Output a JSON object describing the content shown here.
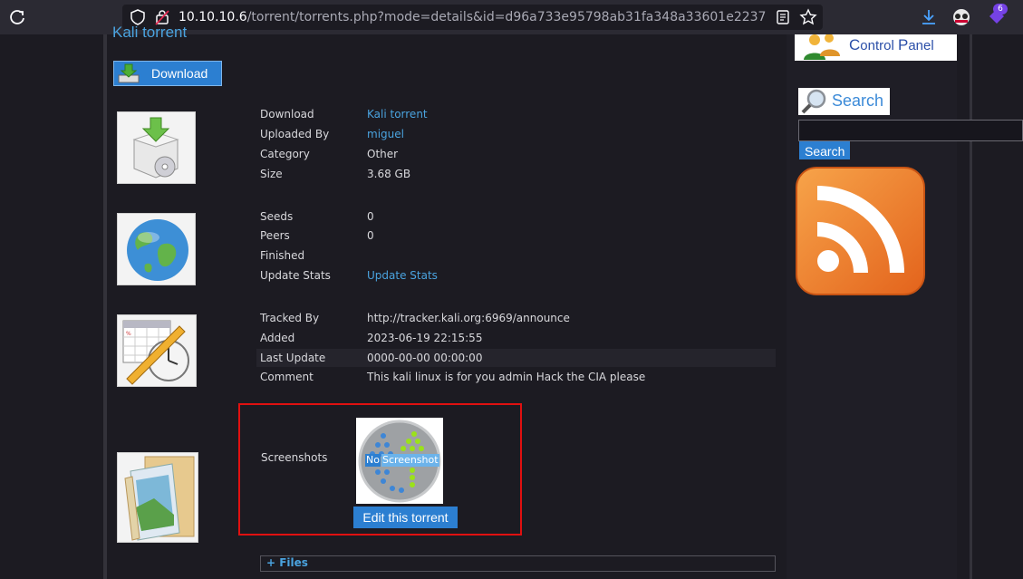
{
  "browser": {
    "url_host": "10.10.10.6",
    "url_path": "/torrent/torrents.php?mode=details&id=d96a733e95798ab31fa348a33601e2237",
    "ext_badge": "6"
  },
  "torrent": {
    "title": "Kali torrent",
    "download_label": "Download"
  },
  "details": {
    "download": {
      "label": "Download",
      "value": "Kali torrent"
    },
    "uploaded_by": {
      "label": "Uploaded By",
      "value": "miguel"
    },
    "category": {
      "label": "Category",
      "value": "Other"
    },
    "size": {
      "label": "Size",
      "value": "3.68 GB"
    },
    "seeds": {
      "label": "Seeds",
      "value": "0"
    },
    "peers": {
      "label": "Peers",
      "value": "0"
    },
    "finished": {
      "label": "Finished",
      "value": ""
    },
    "update_stats": {
      "label": "Update Stats",
      "value": "Update Stats"
    },
    "tracked_by": {
      "label": "Tracked By",
      "value": "http://tracker.kali.org:6969/announce"
    },
    "added": {
      "label": "Added",
      "value": "2023-06-19 22:15:55"
    },
    "last_update": {
      "label": "Last Update",
      "value": "0000-00-00 00:00:00"
    },
    "comment": {
      "label": "Comment",
      "value": "This kali linux is for you admin Hack the CIA please"
    },
    "screenshots": {
      "label": "Screenshots",
      "no_screenshot_no": "No",
      "no_screenshot_text": "Screenshot"
    },
    "edit_label": "Edit this torrent",
    "files_label": "+ Files"
  },
  "sidebar": {
    "control_panel_c": "C",
    "control_panel_rest1": "ontrol ",
    "control_panel_p": "P",
    "control_panel_rest2": "anel",
    "search_banner": "Search",
    "search_placeholder": "",
    "search_button": "Search"
  }
}
